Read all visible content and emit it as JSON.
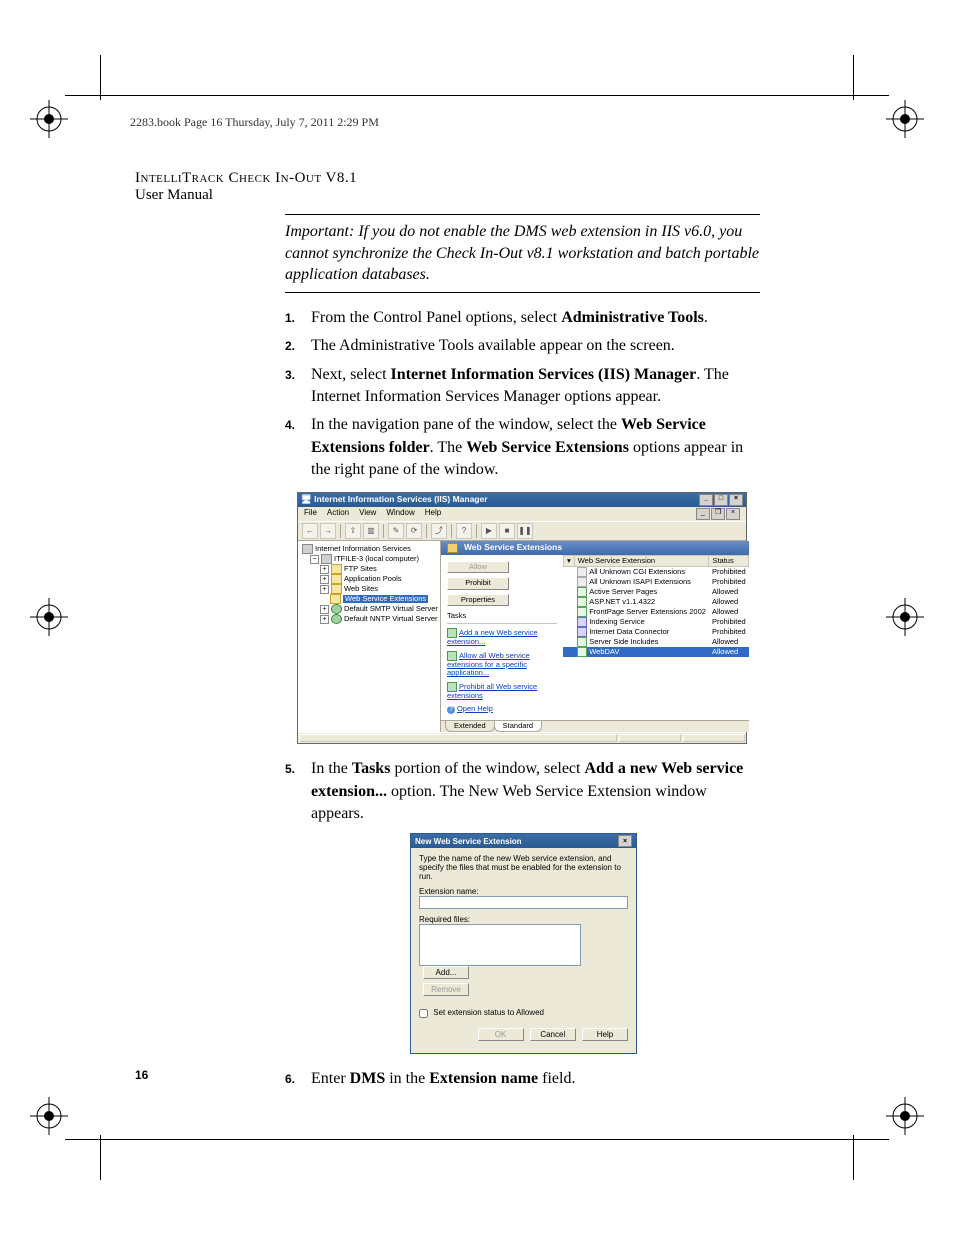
{
  "running_head": "2283.book  Page 16  Thursday, July 7, 2011  2:29 PM",
  "header": {
    "product": "IntelliTrack Check In-Out V8.1",
    "subtitle": "User Manual"
  },
  "important_note": "Important: If you do not enable the DMS web extension in IIS v6.0, you cannot synchronize the Check In-Out v8.1 workstation and batch portable application databases.",
  "steps_part1": {
    "s1": {
      "num": "1.",
      "pre": "From the Control Panel options, select ",
      "bold": "Administrative Tools",
      "post": "."
    },
    "s2": {
      "num": "2.",
      "text": "The Administrative Tools available appear on the screen."
    },
    "s3": {
      "num": "3.",
      "pre": "Next, select ",
      "bold": "Internet Information Services (IIS) Manager",
      "post": ". The Internet Information Services Manager options appear."
    },
    "s4": {
      "num": "4.",
      "pre": "In the navigation pane of the window, select the ",
      "bold1": "Web Service Extensions folder",
      "mid": ". The ",
      "bold2": "Web Service Extensions",
      "post": " options appear in the right pane of the window."
    }
  },
  "steps_part2": {
    "s5": {
      "num": "5.",
      "pre": "In the ",
      "bold1": "Tasks",
      "mid": " portion of the window, select ",
      "bold2": "Add a new Web service extension...",
      "post": " option. The New Web Service Extension window appears."
    },
    "s6": {
      "num": "6.",
      "pre": "Enter ",
      "bold1": "DMS",
      "mid": " in the ",
      "bold2": "Extension name",
      "post": " field."
    }
  },
  "page_number": "16",
  "iis": {
    "title": "Internet Information Services (IIS) Manager",
    "menus": {
      "file": "File",
      "action": "Action",
      "view": "View",
      "window": "Window",
      "help": "Help"
    },
    "toolbar_icons": [
      "back-arrow-icon",
      "forward-arrow-icon",
      "up-icon",
      "show-hide-tree-icon",
      "properties-icon",
      "refresh-icon",
      "export-icon",
      "help-icon",
      "play-icon",
      "stop-icon",
      "pause-icon"
    ],
    "tree": {
      "root": "Internet Information Services",
      "server": "ITFILE-3 (local computer)",
      "nodes": {
        "ftp": "FTP Sites",
        "app_pools": "Application Pools",
        "web_sites": "Web Sites",
        "wse": "Web Service Extensions",
        "smtp": "Default SMTP Virtual Server",
        "nntp": "Default NNTP Virtual Server"
      }
    },
    "right": {
      "header": "Web Service Extensions",
      "buttons": {
        "allow": "Allow",
        "prohibit": "Prohibit",
        "properties": "Properties"
      },
      "tasks_label": "Tasks",
      "links": {
        "add": "Add a new Web service extension...",
        "allow_all": "Allow all Web service extensions for a specific application...",
        "prohibit_all": "Prohibit all Web service extensions",
        "help": "Open Help"
      },
      "columns": {
        "name": "Web Service Extension",
        "status": "Status"
      },
      "rows": [
        {
          "name": "All Unknown CGI Extensions",
          "status": "Prohibited",
          "icon": "unknown"
        },
        {
          "name": "All Unknown ISAPI Extensions",
          "status": "Prohibited",
          "icon": "unknown"
        },
        {
          "name": "Active Server Pages",
          "status": "Allowed",
          "icon": "allowed"
        },
        {
          "name": "ASP.NET v1.1.4322",
          "status": "Allowed",
          "icon": "allowed"
        },
        {
          "name": "FrontPage Server Extensions 2002",
          "status": "Allowed",
          "icon": "allowed"
        },
        {
          "name": "Indexing Service",
          "status": "Prohibited",
          "icon": "gear"
        },
        {
          "name": "Internet Data Connector",
          "status": "Prohibited",
          "icon": "gear"
        },
        {
          "name": "Server Side Includes",
          "status": "Allowed",
          "icon": "allowed"
        },
        {
          "name": "WebDAV",
          "status": "Allowed",
          "icon": "allowed",
          "selected": true
        }
      ],
      "tabs": {
        "extended": "Extended",
        "standard": "Standard"
      }
    }
  },
  "dialog": {
    "title": "New Web Service Extension",
    "intro": "Type the name of the new Web service extension, and specify the files that must be enabled for the extension to run.",
    "ext_label": "Extension name:",
    "ext_value": "",
    "req_label": "Required files:",
    "btn_add": "Add...",
    "btn_remove": "Remove",
    "chk_label": "Set extension status to Allowed",
    "btn_ok": "OK",
    "btn_cancel": "Cancel",
    "btn_help": "Help"
  }
}
